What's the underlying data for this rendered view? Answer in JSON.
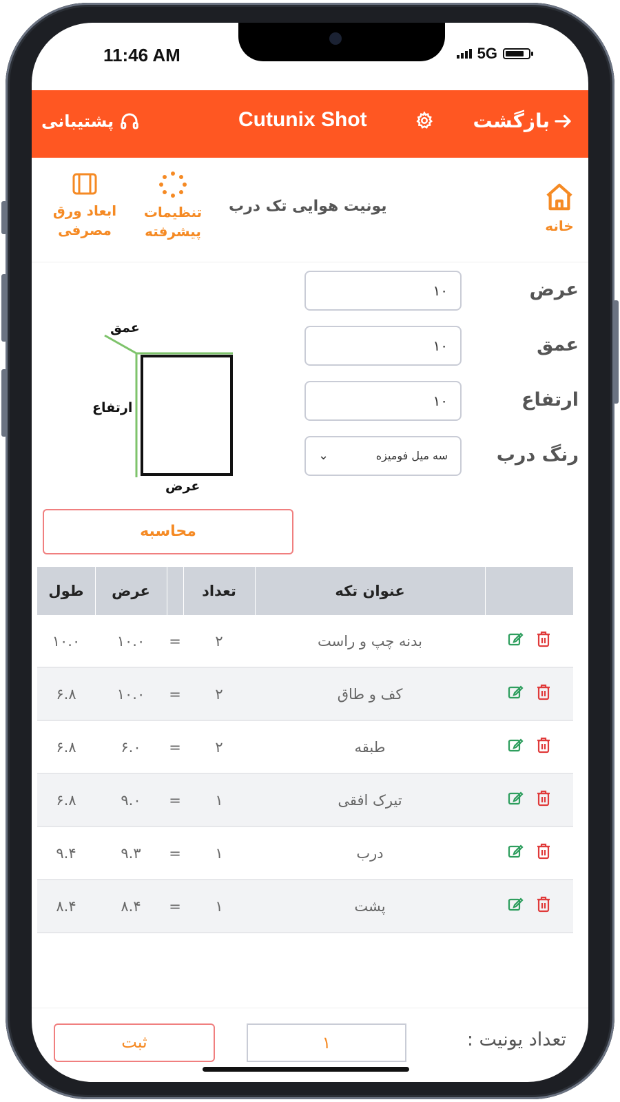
{
  "status_bar": {
    "time": "11:46 AM",
    "network": "5G"
  },
  "header": {
    "support_label": "پشتیبانی",
    "title": "Cutunix Shot",
    "back_label": "بازگشت",
    "accent_color": "#ff5722"
  },
  "toolbar": {
    "home_label": "خانه",
    "page_title": "یونیت هوایی تک درب",
    "settings_label_line1": "تنظیمات",
    "settings_label_line2": "پیشرفته",
    "sheet_label_line1": "ابعاد ورق",
    "sheet_label_line2": "مصرفی"
  },
  "form": {
    "width_label": "عرض",
    "width_value": "۱۰",
    "depth_label": "عمق",
    "depth_value": "۱۰",
    "height_label": "ارتفاع",
    "height_value": "۱۰",
    "door_color_label": "رنگ درب",
    "door_color_value": "سه میل فومیزه"
  },
  "diagram": {
    "depth_label": "عمق",
    "height_label": "ارتفاع",
    "width_label": "عرض"
  },
  "calculate_label": "محاسبه",
  "table": {
    "headers": {
      "length": "طول",
      "width": "عرض",
      "count": "تعداد",
      "title": "عنوان تکه"
    },
    "rows": [
      {
        "title": "بدنه چپ و راست",
        "count": "۲",
        "eq": "=",
        "width": "۱۰.۰",
        "length": "۱۰.۰"
      },
      {
        "title": "کف و طاق",
        "count": "۲",
        "eq": "=",
        "width": "۱۰.۰",
        "length": "۶.۸"
      },
      {
        "title": "طبقه",
        "count": "۲",
        "eq": "=",
        "width": "۶.۰",
        "length": "۶.۸"
      },
      {
        "title": "تیرک افقی",
        "count": "۱",
        "eq": "=",
        "width": "۹.۰",
        "length": "۶.۸"
      },
      {
        "title": "درب",
        "count": "۱",
        "eq": "=",
        "width": "۹.۳",
        "length": "۹.۴"
      },
      {
        "title": "پشت",
        "count": "۱",
        "eq": "=",
        "width": "۸.۴",
        "length": "۸.۴"
      }
    ]
  },
  "footer": {
    "unit_count_label": "تعداد یونیت :",
    "unit_count_value": "۱",
    "save_label": "ثبت"
  }
}
